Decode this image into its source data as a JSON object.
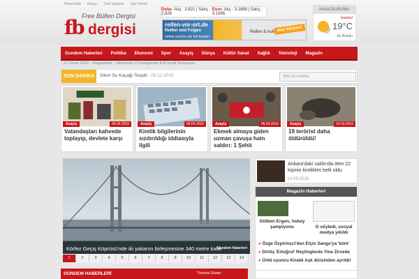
{
  "top_links": [
    "Firma Ekle",
    "Künye",
    "Tüm Yazarlar",
    "Üye Paneli"
  ],
  "logo": {
    "tagline": "Free Bülten Dergisi",
    "fb": "fb",
    "dergisi": "dergisi"
  },
  "currency": {
    "dolar_label": "Dolar",
    "dolar_text": ": Alış : 2.821 | Satış : 2.826",
    "euro_label": "Euro",
    "euro_text": ": Alış : 3.1888 | Satış : 3.1945"
  },
  "banner": {
    "line1": "reifen-vor-ort.de",
    "line2": "Reifen und Felgen",
    "line3": "online suchen vor Ort kaufen",
    "line4": "Reifen & Aufelgen",
    "cta": "Hier klicken!"
  },
  "weather": {
    "header": "HAVA DURUMU",
    "city": "İstanbul",
    "temp": "19°C",
    "condition": "Az Bulutlu"
  },
  "nav": [
    "Gundem Haberleri",
    "Politika",
    "Ekonomi",
    "Spor",
    "Asayiş",
    "Dünya",
    "Kültür Sanat",
    "Sağlık",
    "Teknoloji",
    "Magazin"
  ],
  "info_line": "22 Nisan 2016 - Hoşgeldiniz - Sitemizde 19 Kategoride 418 İçerik Bulunuyor.",
  "breaking": {
    "label": "SON DAKİKA",
    "text": "Silivri Su Kaçağı Tespiti",
    "date": "- 05.12.2015",
    "search_placeholder": "Site İçi Arama"
  },
  "cards": [
    {
      "category": "Asayiş",
      "date": "06.04.2016",
      "title": "Vatandaşları kahvede toplayıp, devlete karşı"
    },
    {
      "category": "Asayiş",
      "date": "06.04.2016",
      "title": "Kimlik bilgilerinin sızdırıldığı iddiasıyla ilgili"
    },
    {
      "category": "Asayiş",
      "date": "06.04.2016",
      "title": "Ekmek almaya giden uzman çavuşa hain saldırı: 1 Şehit"
    },
    {
      "category": "Asayiş",
      "date": "14.03.2016",
      "title": "19 terörist daha öldürüldü!"
    }
  ],
  "slider": {
    "caption": "Körfez Geçiş Köprüsü'nde iki yakanın birleşmesine 340 metre kaldı",
    "category": "Gundem Haberleri",
    "pages": [
      "1",
      "2",
      "3",
      "4",
      "5",
      "6",
      "7",
      "8",
      "9",
      "10",
      "11",
      "12",
      "13",
      "14"
    ],
    "active_page": "1"
  },
  "side_top": {
    "title": "Ankara'daki saldırıda ölen 22 kişinin kimlikleri belli oldu",
    "date": "14.03.2016"
  },
  "magazin": {
    "header": "Magazin Haberleri",
    "caption1": "Gülben Ergen, hokey şampiyonu",
    "caption2": "O söyledi, sosyal medya yıkıldı",
    "items": [
      "Özge Özpirinçci'den Elçin Sangu'ya 'kürk'",
      "Diriliş 'Ertuğrul' Reytinglerde Yine Zirvede",
      "Ünlü oyuncu Kiralık Aşk dizisinden ayrıldı!"
    ]
  },
  "bottom": {
    "header": "GÜNDEM HABERLERİ",
    "all": "Tümünü Göster"
  }
}
